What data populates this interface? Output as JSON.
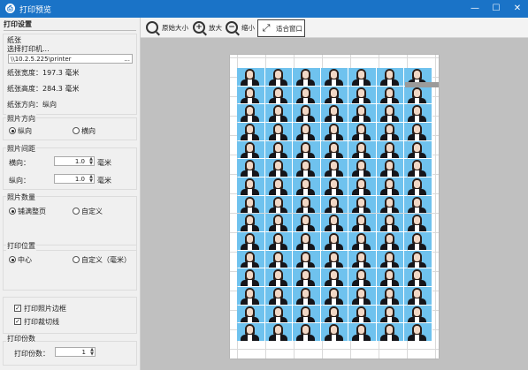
{
  "window": {
    "title": "打印预览",
    "app_icon": "printer-app-icon",
    "min": "—",
    "max": "☐",
    "close": "✕"
  },
  "sidebar": {
    "header": "打印设置",
    "paper": {
      "label": "纸张",
      "choose_printer": "选择打印机...",
      "printer_path": "\\\\10.2.5.225\\printer",
      "browse": "...",
      "width": "纸张宽度：197.3 毫米",
      "height": "纸张高度：284.3 毫米",
      "orientation": "纸张方向：纵向"
    },
    "photo_orientation": {
      "label": "照片方向",
      "portrait": "纵向",
      "landscape": "横向",
      "selected": "portrait"
    },
    "photo_spacing": {
      "label": "照片间距",
      "horizontal_label": "横向：",
      "horizontal_value": "1.0",
      "vertical_label": "纵向：",
      "vertical_value": "1.0",
      "unit": "毫米"
    },
    "photo_count": {
      "label": "照片数量",
      "fill_page": "铺满整页",
      "custom": "自定义",
      "selected": "fill_page"
    },
    "print_position": {
      "label": "打印位置",
      "center": "中心",
      "custom": "自定义（毫米）",
      "selected": "center"
    },
    "print_border": {
      "label": "打印照片边框",
      "checked": true
    },
    "print_cutline": {
      "label": "打印裁切线",
      "checked": true
    },
    "copies": {
      "label": "打印份数",
      "field_label": "打印份数：",
      "value": "1"
    }
  },
  "toolbar": {
    "original_size": "原始大小",
    "zoom_in": "放大",
    "zoom_out": "缩小",
    "fit_window": "适合窗口"
  },
  "preview": {
    "photo_grid": {
      "columns": 7,
      "rows": 15
    },
    "photo_bg_color": "#6fc2ee",
    "canvas_color": "#c0c0c0"
  }
}
